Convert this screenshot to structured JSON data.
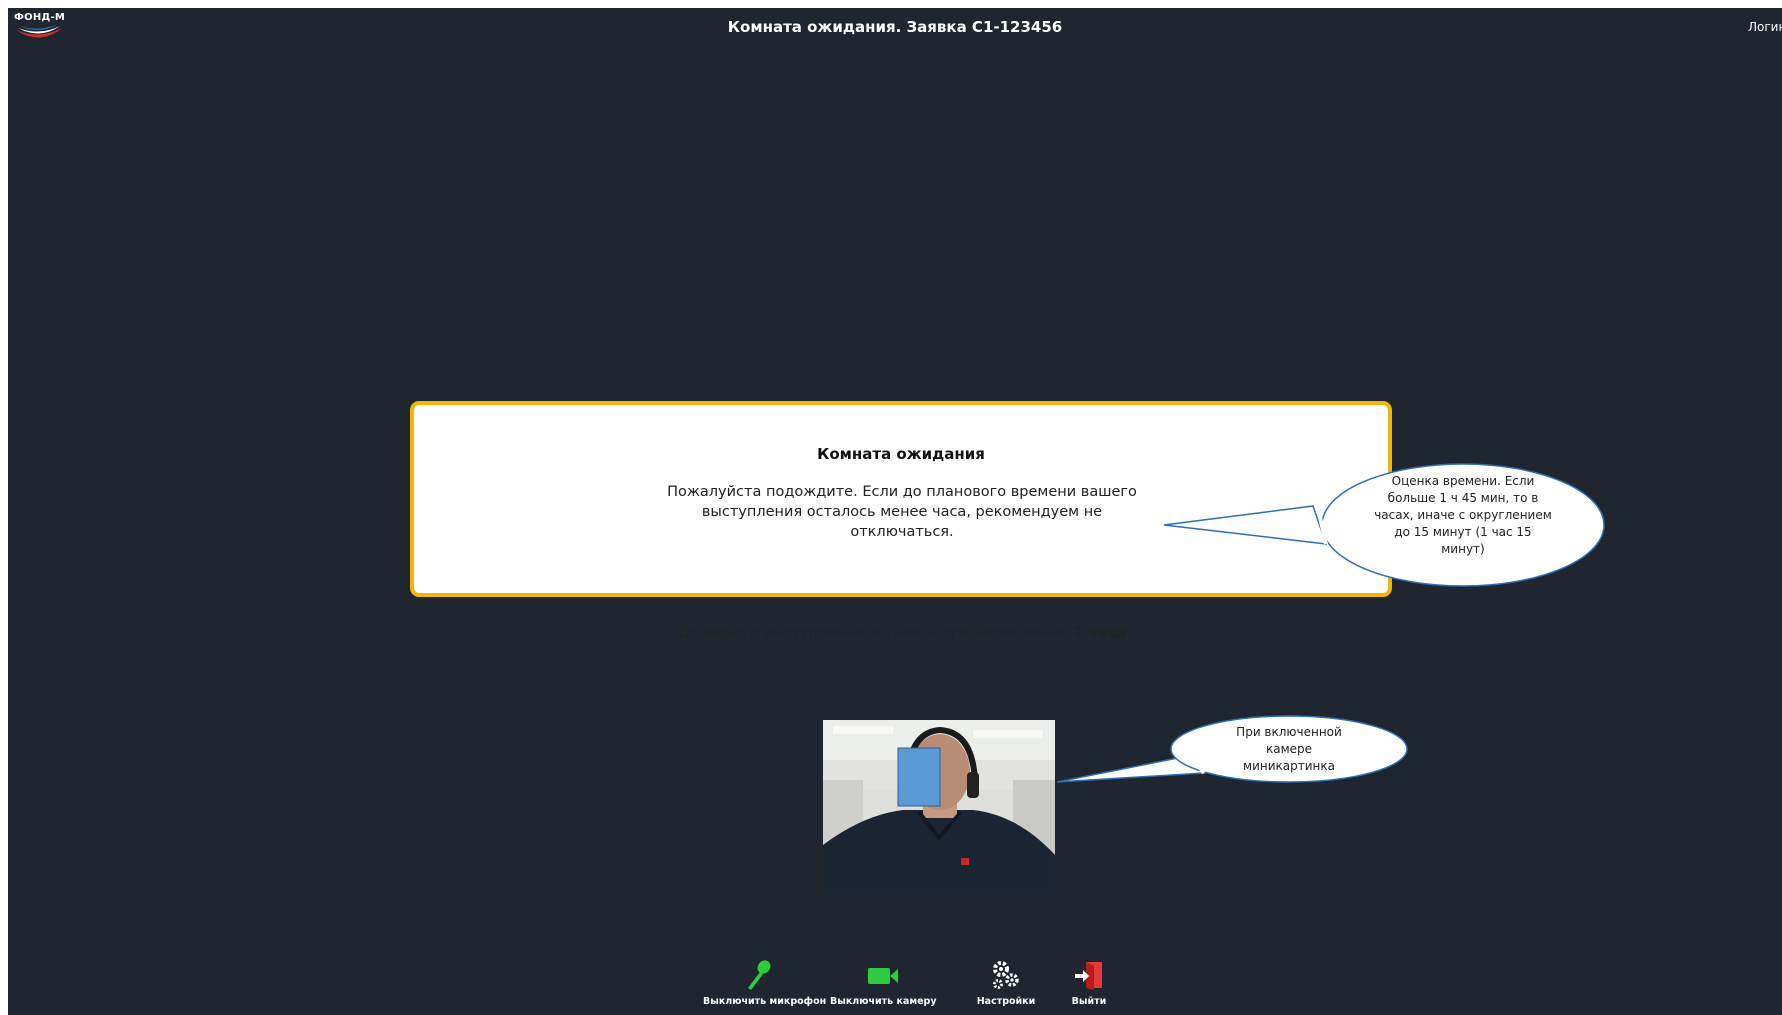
{
  "brand": {
    "name": "ФОНД-М",
    "logo_colors": [
      "#2c6fb5",
      "#d32f2f",
      "#ffffff"
    ]
  },
  "header": {
    "title": "Комната ожидания. Заявка С1-123456",
    "login_label": "Логин"
  },
  "dialog": {
    "title": "Комната ожидания",
    "message": "Пожалуйста подождите. Если до планового времени вашего выступления осталось менее часа,  рекомендуем не отключаться.",
    "remaining_prefix": "До вашего выступления осталось приблизительно ",
    "remaining_value": "2 часа",
    "border_color": "#f2b705"
  },
  "callouts": {
    "time_estimate": "Оценка времени. Если больше 1 ч 45 мин, то в часах, иначе с округлением до 15 минут (1 час 15 минут)",
    "camera_thumbnail": "При включенной камере миникартинка"
  },
  "camera_preview": {
    "icon": "webcam-thumbnail"
  },
  "toolbar": {
    "items": [
      {
        "label": "Выключить микрофон",
        "icon": "microphone-icon",
        "color": "#2ecc40"
      },
      {
        "label": "Выключить камеру",
        "icon": "video-camera-icon",
        "color": "#2ecc40"
      },
      {
        "label": "Настройки",
        "icon": "gear-icon",
        "color": "#ffffff"
      },
      {
        "label": "Выйти",
        "icon": "exit-icon",
        "color": "#e53935"
      }
    ]
  },
  "colors": {
    "background": "#1f2630",
    "accent": "#f2b705"
  }
}
